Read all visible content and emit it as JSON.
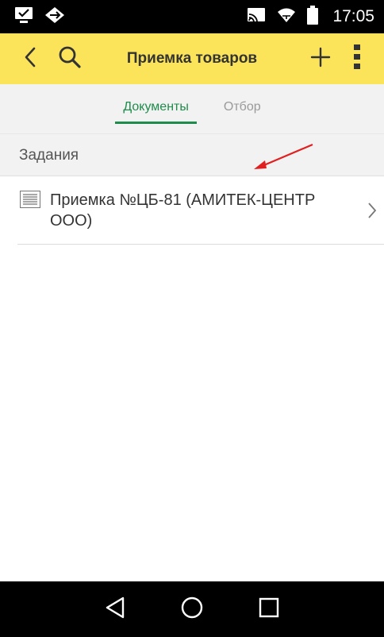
{
  "status_bar": {
    "time": "17:05",
    "icons": [
      "device-check-icon",
      "diamond-arrows-icon",
      "cast-icon",
      "wifi-icon",
      "battery-icon"
    ]
  },
  "app_bar": {
    "title": "Приемка товаров",
    "background_color": "#fbe45a",
    "icons": [
      "back-icon",
      "search-icon",
      "plus-icon",
      "more-vertical-icon"
    ]
  },
  "tabs": [
    {
      "label": "Документы",
      "active": true
    },
    {
      "label": "Отбор",
      "active": false
    }
  ],
  "accent_color": "#1e8c4a",
  "section": {
    "title": "Задания"
  },
  "list": [
    {
      "label": "Приемка №ЦБ-81 (АМИТЕК-ЦЕНТР ООО)",
      "icon": "document-icon"
    }
  ],
  "annotation": {
    "color": "#e02020",
    "icon": "red-arrow-annotation"
  },
  "nav_bar": {
    "icons": [
      "nav-back-icon",
      "nav-home-icon",
      "nav-recents-icon"
    ]
  }
}
